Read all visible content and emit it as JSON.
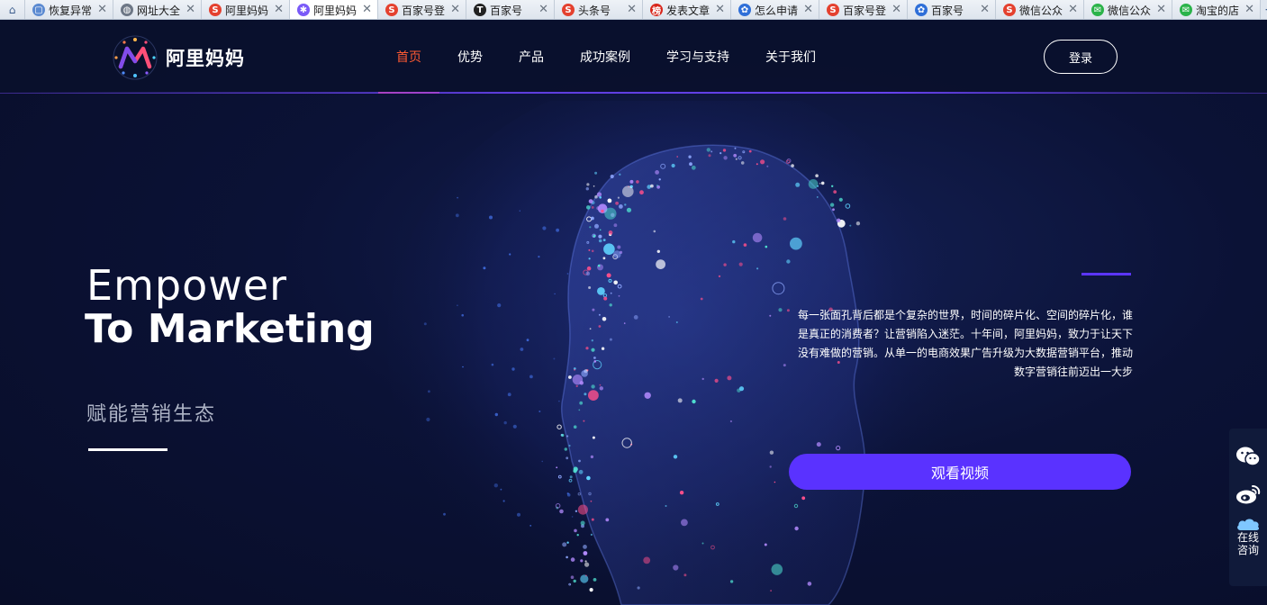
{
  "browser": {
    "tabs": [
      {
        "label": "恢复异常",
        "icon": "page-icon",
        "color": "#5b8ad1"
      },
      {
        "label": "网址大全",
        "icon": "globe-icon",
        "color": "#6d7786"
      },
      {
        "label": "阿里妈妈",
        "icon": "sogou-icon",
        "color": "#e4412f"
      },
      {
        "label": "阿里妈妈",
        "icon": "alimama-icon",
        "color": "#7a5af8",
        "active": true
      },
      {
        "label": "百家号登",
        "icon": "sogou-icon",
        "color": "#e4412f"
      },
      {
        "label": "百家号",
        "icon": "toutiao-icon",
        "color": "#222222"
      },
      {
        "label": "头条号",
        "icon": "sogou-icon",
        "color": "#e4412f"
      },
      {
        "label": "发表文章",
        "icon": "bang-icon",
        "color": "#d8261b"
      },
      {
        "label": "怎么申请",
        "icon": "baidu-paw-icon",
        "color": "#2f6fd8"
      },
      {
        "label": "百家号登",
        "icon": "sogou-icon",
        "color": "#e4412f"
      },
      {
        "label": "百家号",
        "icon": "baidu-paw-icon",
        "color": "#2f6fd8"
      },
      {
        "label": "微信公众",
        "icon": "sogou-icon",
        "color": "#e4412f"
      },
      {
        "label": "微信公众",
        "icon": "wechat-icon",
        "color": "#2bb34a"
      },
      {
        "label": "淘宝的店",
        "icon": "wechat-icon",
        "color": "#2bb34a"
      }
    ]
  },
  "header": {
    "logo_text": "阿里妈妈",
    "nav": [
      {
        "label": "首页",
        "active": true
      },
      {
        "label": "优势"
      },
      {
        "label": "产品"
      },
      {
        "label": "成功案例"
      },
      {
        "label": "学习与支持"
      },
      {
        "label": "关于我们"
      }
    ],
    "login_label": "登录"
  },
  "hero": {
    "title_line1": "Empower",
    "title_line2": "To Marketing",
    "subtitle": "赋能营销生态",
    "description": "每一张面孔背后都是个复杂的世界，时间的碎片化、空间的碎片化，谁是真正的消费者？让营销陷入迷茫。十年间，阿里妈妈，致力于让天下没有难做的营销。从单一的电商效果广告升级为大数据营销平台，推动数字营销往前迈出一大步",
    "video_button": "观看视频"
  },
  "sidebar": {
    "items": [
      {
        "icon": "wechat-icon"
      },
      {
        "icon": "weibo-icon"
      },
      {
        "icon": "chat-cloud-icon",
        "label": "在线咨询"
      }
    ]
  },
  "colors": {
    "accent": "#5a32ff",
    "nav_active": "#ff5a32",
    "background": "#0b1236"
  }
}
